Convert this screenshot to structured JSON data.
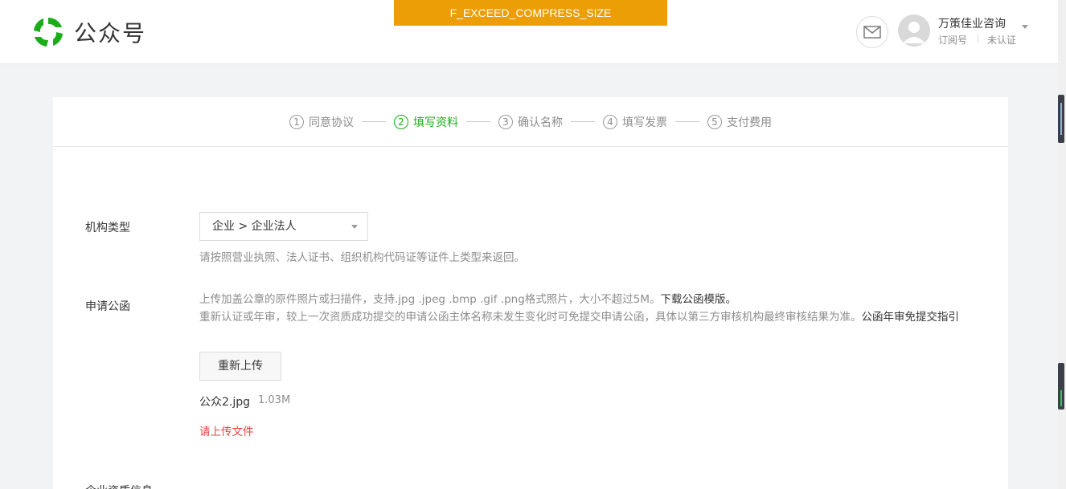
{
  "header": {
    "logo_text": "公众号",
    "error_banner": "F_EXCEED_COMPRESS_SIZE",
    "mail_icon": "mail-icon",
    "account_name": "万策佳业咨询",
    "account_type": "订阅号",
    "account_status": "未认证"
  },
  "steps": [
    {
      "num": "1",
      "label": "同意协议",
      "active": false
    },
    {
      "num": "2",
      "label": "填写资料",
      "active": true
    },
    {
      "num": "3",
      "label": "确认名称",
      "active": false
    },
    {
      "num": "4",
      "label": "填写发票",
      "active": false
    },
    {
      "num": "5",
      "label": "支付费用",
      "active": false
    }
  ],
  "form": {
    "org_type": {
      "label": "机构类型",
      "selected": "企业 > 企业法人",
      "hint": "请按照营业执照、法人证书、组织机构代码证等证件上类型来返回。"
    },
    "letter": {
      "label": "申请公函",
      "hint_line1": "上传加盖公章的原件照片或扫描件，支持.jpg .jpeg .bmp .gif .png格式照片，大小不超过5M。",
      "hint_link1": "下载公函模版。",
      "hint_line2": "重新认证或年审，较上一次资质成功提交的申请公函主体名称未发生变化时可免提交申请公函，具体以第三方审核机构最终审核结果为准。",
      "hint_link2": "公函年审免提交指引",
      "reupload_button": "重新上传",
      "file_name": "公众2.jpg",
      "file_size": "1.03M",
      "error": "请上传文件"
    },
    "next_label": "企业资质信息"
  },
  "colors": {
    "accent": "#1aad19",
    "banner": "#eb9e05",
    "error": "#e64340"
  }
}
